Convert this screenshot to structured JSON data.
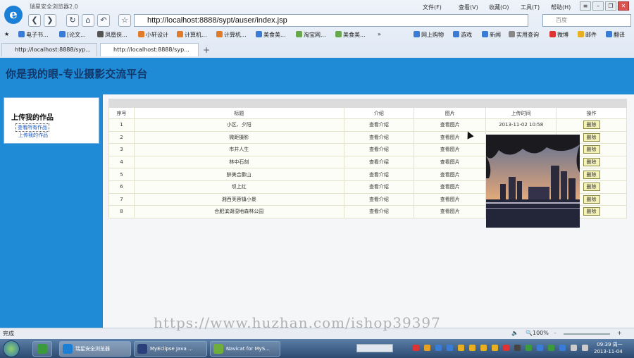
{
  "browser": {
    "window_title": "瑞星安全浏览器2.0",
    "menu": [
      "文件(F)",
      "查看(V)",
      "收藏(O)",
      "工具(T)",
      "帮助(H)"
    ],
    "address": "http://localhost:8888/sypt/auser/index.jsp",
    "search_placeholder": "百度",
    "favorites": [
      "电子书...",
      "[论文...",
      "凤凰侠...",
      "小轩设计",
      "计算机...",
      "计算机...",
      "美食美...",
      "淘宝网...",
      "美食美...",
      "网上购物",
      "游戏",
      "新闻",
      "实用查询",
      "微博",
      "邮件",
      "翻译"
    ],
    "tabs": [
      {
        "label": "http://localhost:8888/syp..."
      },
      {
        "label": "http://localhost:8888/syp..."
      }
    ]
  },
  "page": {
    "title": "你是我的眼-专业摄影交流平台",
    "sidebar": {
      "heading": "上传我的作品",
      "links": [
        "查看所有作品",
        "上传我的作品"
      ]
    },
    "table": {
      "headers": [
        "序号",
        "标题",
        "介绍",
        "图片",
        "上传时间",
        "操作"
      ],
      "rows": [
        {
          "no": "1",
          "title": "小区、夕阳",
          "intro": "查看介绍",
          "pic": "查看图片",
          "time": "2013-11-02 10:58",
          "action": "删除"
        },
        {
          "no": "2",
          "title": "微距摄影",
          "intro": "查看介绍",
          "pic": "查看图片",
          "time": "",
          "action": "删除"
        },
        {
          "no": "3",
          "title": "市井人生",
          "intro": "查看介绍",
          "pic": "查看图片",
          "time": "",
          "action": "删除"
        },
        {
          "no": "4",
          "title": "林中石刻",
          "intro": "查看介绍",
          "pic": "查看图片",
          "time": "",
          "action": "删除"
        },
        {
          "no": "5",
          "title": "醉美合歡山",
          "intro": "查看介绍",
          "pic": "查看图片",
          "time": "",
          "action": "删除"
        },
        {
          "no": "6",
          "title": "坝上红",
          "intro": "查看介绍",
          "pic": "查看图片",
          "time": "",
          "action": "删除"
        },
        {
          "no": "7",
          "title": "湘西芙蓉镇小景",
          "intro": "查看介绍",
          "pic": "查看图片",
          "time": "",
          "action": "删除"
        },
        {
          "no": "8",
          "title": "合肥滨湖湿地森林公园",
          "intro": "查看介绍",
          "pic": "查看图片",
          "time": "",
          "action": "删除"
        }
      ]
    }
  },
  "status": {
    "left": "完成",
    "zoom": "100%"
  },
  "taskbar": {
    "items": [
      "瑞星安全浏览器",
      "MyEclipse Java ...",
      "Navicat for MyS..."
    ],
    "time": "09:39",
    "weekday": "周一",
    "date": "2013-11-04"
  },
  "watermark": "https://www.huzhan.com/ishop39397"
}
